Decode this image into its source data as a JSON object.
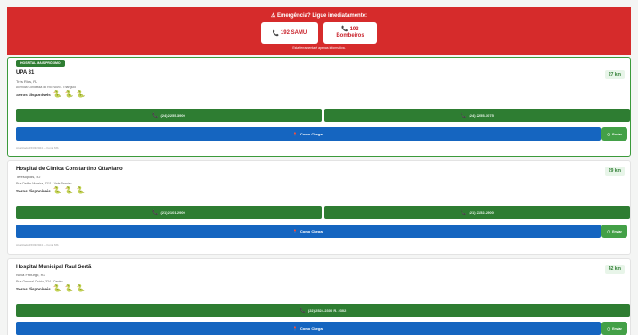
{
  "emergency": {
    "title": "⚠ Emergência? Ligue imediatamente:",
    "samu": "192 SAMU",
    "bombeiros_num": "193",
    "bombeiros_label": "Bombeiros",
    "note": "Esta ferramenta é apenas informativa."
  },
  "hospitals": [
    {
      "badge": "HOSPITAL MAIS PRÓXIMO",
      "name": "UPA 31",
      "city": "Três Rios, RJ",
      "address": "Avenida Condessa do Rio Novo - Triangulo",
      "sera_label": "Soros disponíveis",
      "distance": "27 km",
      "phones": [
        "(24) 2255-3900",
        "(24) 2255-3075"
      ],
      "directions": "Como Chegar",
      "send": "Enviar",
      "meta": "Atualizado 15/03/2024 — Fonte MS"
    },
    {
      "name": "Hospital de Clínica Constantino Ottaviano",
      "city": "Teresópolis, RJ",
      "address": "Rua Delfim Moreira, 2211 - Vale Paraíso",
      "sera_label": "Soros disponíveis",
      "distance": "29 km",
      "phones": [
        "(21) 2101-2900",
        "(21) 2152-2900"
      ],
      "directions": "Como Chegar",
      "send": "Enviar",
      "meta": "Atualizado 15/03/2024 — Fonte MS"
    },
    {
      "name": "Hospital Municipal Raul Sertã",
      "city": "Nova Friburgo, RJ",
      "address": "Rua General Osório, 324 - Centro",
      "sera_label": "Soros disponíveis",
      "distance": "42 km",
      "phones": [
        "(22) 2524-2300 R. 2302"
      ],
      "directions": "Como Chegar",
      "send": "Enviar"
    }
  ],
  "icons": {
    "phone": "phone-icon",
    "pin": "map-pin-icon",
    "whatsapp": "whatsapp-icon",
    "snake": "snake-icon"
  }
}
